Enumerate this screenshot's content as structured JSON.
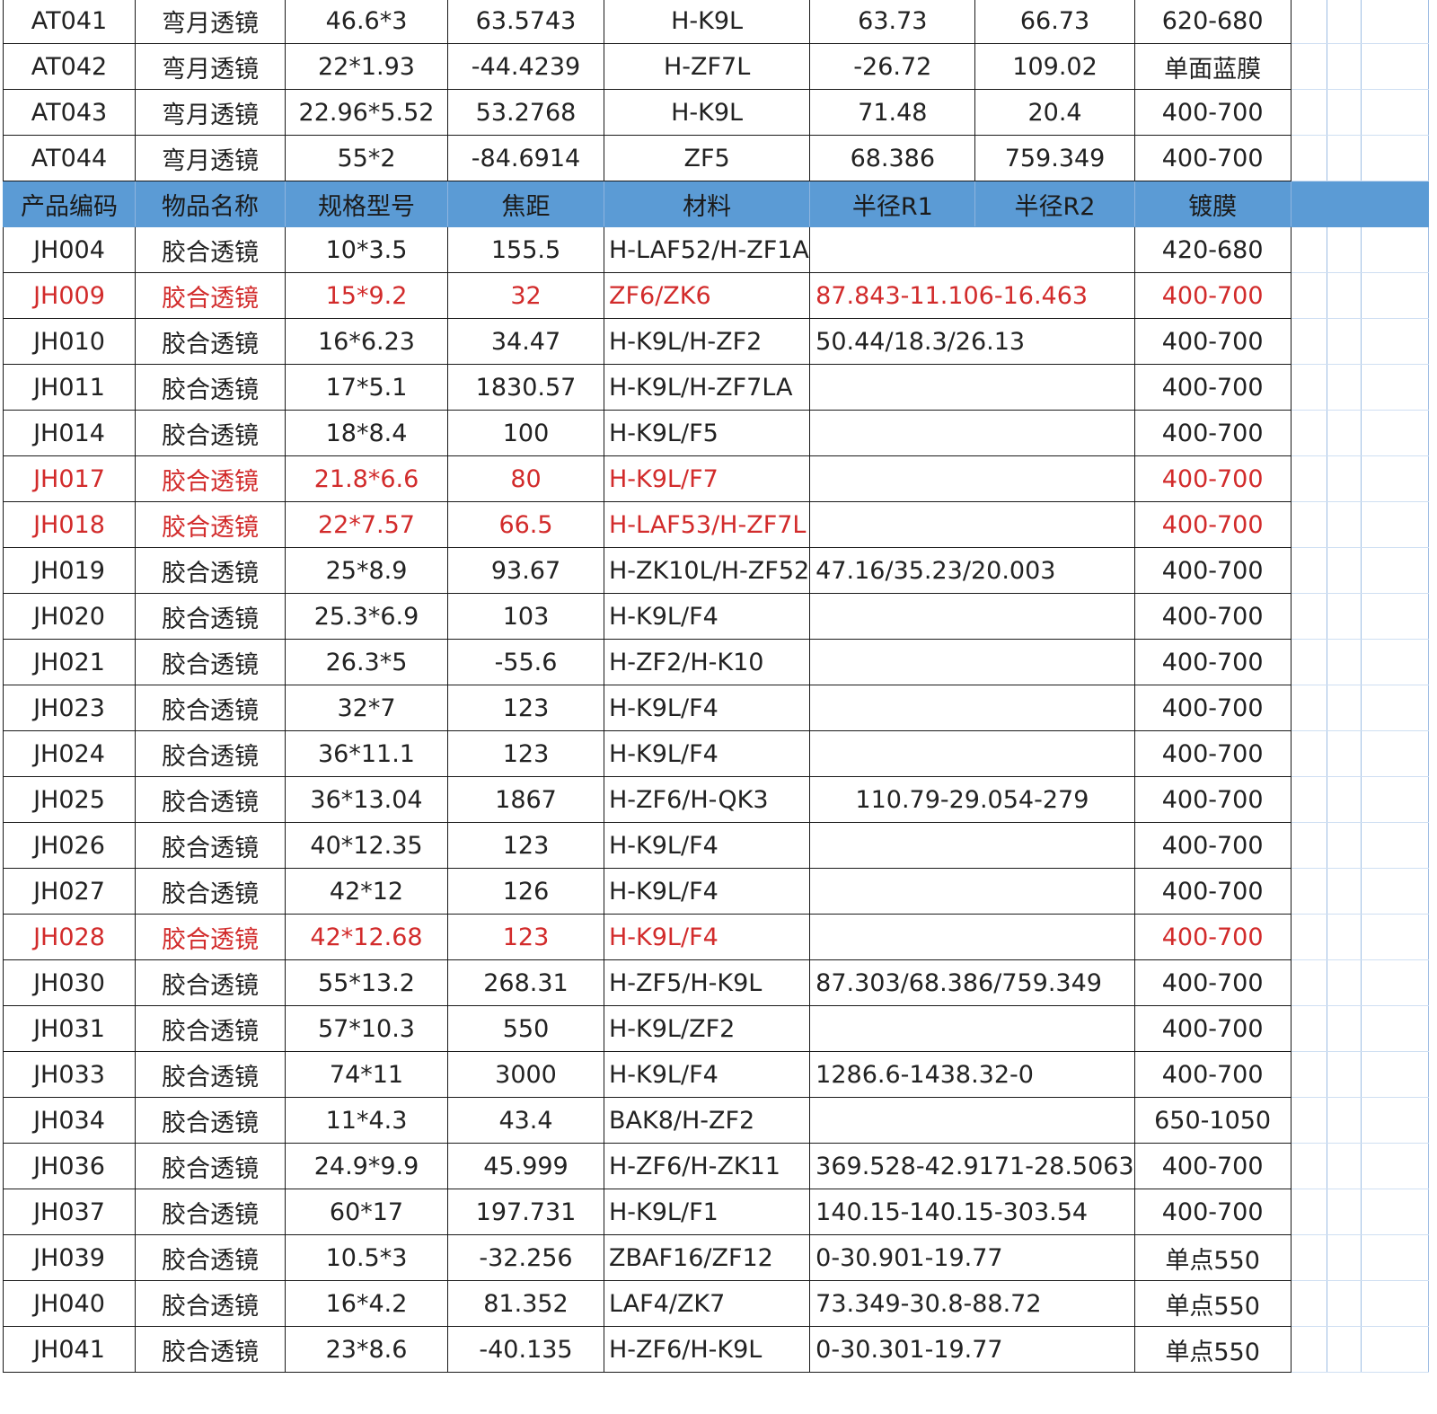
{
  "top_rows": [
    {
      "code": "AT041",
      "name": "弯月透镜",
      "spec": "46.6*3",
      "focal": "63.5743",
      "material": "H-K9L",
      "r1": "63.73",
      "r2": "66.73",
      "coating": "620-680"
    },
    {
      "code": "AT042",
      "name": "弯月透镜",
      "spec": "22*1.93",
      "focal": "-44.4239",
      "material": "H-ZF7L",
      "r1": "-26.72",
      "r2": "109.02",
      "coating": "单面蓝膜"
    },
    {
      "code": "AT043",
      "name": "弯月透镜",
      "spec": "22.96*5.52",
      "focal": "53.2768",
      "material": "H-K9L",
      "r1": "71.48",
      "r2": "20.4",
      "coating": "400-700"
    },
    {
      "code": "AT044",
      "name": "弯月透镜",
      "spec": "55*2",
      "focal": "-84.6914",
      "material": "ZF5",
      "r1": "68.386",
      "r2": "759.349",
      "coating": "400-700"
    }
  ],
  "header": {
    "code": "产品编码",
    "name": "物品名称",
    "spec": "规格型号",
    "focal": "焦距",
    "material": "材料",
    "r1": "半径R1",
    "r2": "半径R2",
    "coating": "镀膜"
  },
  "rows": [
    {
      "code": "JH004",
      "name": "胶合透镜",
      "spec": "10*3.5",
      "focal": "155.5",
      "material": "H-LAF52/H-ZF1A",
      "radius": "",
      "coating": "420-680",
      "red": false
    },
    {
      "code": "JH009",
      "name": "胶合透镜",
      "spec": "15*9.2",
      "focal": "32",
      "material": "ZF6/ZK6",
      "radius": "87.843-11.106-16.463",
      "coating": "400-700",
      "red": true
    },
    {
      "code": "JH010",
      "name": "胶合透镜",
      "spec": "16*6.23",
      "focal": "34.47",
      "material": "H-K9L/H-ZF2",
      "radius": "50.44/18.3/26.13",
      "coating": "400-700",
      "red": false
    },
    {
      "code": "JH011",
      "name": "胶合透镜",
      "spec": "17*5.1",
      "focal": "1830.57",
      "material": "H-K9L/H-ZF7LA",
      "radius": "",
      "coating": "400-700",
      "red": false
    },
    {
      "code": "JH014",
      "name": "胶合透镜",
      "spec": "18*8.4",
      "focal": "100",
      "material": "H-K9L/F5",
      "radius": "",
      "coating": "400-700",
      "red": false
    },
    {
      "code": "JH017",
      "name": "胶合透镜",
      "spec": "21.8*6.6",
      "focal": "80",
      "material": "H-K9L/F7",
      "radius": "",
      "coating": "400-700",
      "red": true
    },
    {
      "code": "JH018",
      "name": "胶合透镜",
      "spec": "22*7.57",
      "focal": "66.5",
      "material": "H-LAF53/H-ZF7L",
      "radius": "",
      "coating": "400-700",
      "red": true
    },
    {
      "code": "JH019",
      "name": "胶合透镜",
      "spec": "25*8.9",
      "focal": "93.67",
      "material": "H-ZK10L/H-ZF52",
      "radius": "47.16/35.23/20.003",
      "coating": "400-700",
      "red": false
    },
    {
      "code": "JH020",
      "name": "胶合透镜",
      "spec": "25.3*6.9",
      "focal": "103",
      "material": "H-K9L/F4",
      "radius": "",
      "coating": "400-700",
      "red": false
    },
    {
      "code": "JH021",
      "name": "胶合透镜",
      "spec": "26.3*5",
      "focal": "-55.6",
      "material": "H-ZF2/H-K10",
      "radius": "",
      "coating": "400-700",
      "red": false
    },
    {
      "code": "JH023",
      "name": "胶合透镜",
      "spec": "32*7",
      "focal": "123",
      "material": "H-K9L/F4",
      "radius": "",
      "coating": "400-700",
      "red": false
    },
    {
      "code": "JH024",
      "name": "胶合透镜",
      "spec": "36*11.1",
      "focal": "123",
      "material": "H-K9L/F4",
      "radius": "",
      "coating": "400-700",
      "red": false
    },
    {
      "code": "JH025",
      "name": "胶合透镜",
      "spec": "36*13.04",
      "focal": "1867",
      "material": "H-ZF6/H-QK3",
      "radius": "110.79-29.054-279",
      "coating": "400-700",
      "red": false,
      "center": true
    },
    {
      "code": "JH026",
      "name": "胶合透镜",
      "spec": "40*12.35",
      "focal": "123",
      "material": "H-K9L/F4",
      "radius": "",
      "coating": "400-700",
      "red": false
    },
    {
      "code": "JH027",
      "name": "胶合透镜",
      "spec": "42*12",
      "focal": "126",
      "material": "H-K9L/F4",
      "radius": "",
      "coating": "400-700",
      "red": false
    },
    {
      "code": "JH028",
      "name": "胶合透镜",
      "spec": "42*12.68",
      "focal": "123",
      "material": "H-K9L/F4",
      "radius": "",
      "coating": "400-700",
      "red": true
    },
    {
      "code": "JH030",
      "name": "胶合透镜",
      "spec": "55*13.2",
      "focal": "268.31",
      "material": "H-ZF5/H-K9L",
      "radius": "87.303/68.386/759.349",
      "coating": "400-700",
      "red": false
    },
    {
      "code": "JH031",
      "name": "胶合透镜",
      "spec": "57*10.3",
      "focal": "550",
      "material": "H-K9L/ZF2",
      "radius": "",
      "coating": "400-700",
      "red": false
    },
    {
      "code": "JH033",
      "name": "胶合透镜",
      "spec": "74*11",
      "focal": "3000",
      "material": "H-K9L/F4",
      "radius": "1286.6-1438.32-0",
      "coating": "400-700",
      "red": false
    },
    {
      "code": "JH034",
      "name": "胶合透镜",
      "spec": "11*4.3",
      "focal": "43.4",
      "material": "BAK8/H-ZF2",
      "radius": "",
      "coating": "650-1050",
      "red": false
    },
    {
      "code": "JH036",
      "name": "胶合透镜",
      "spec": "24.9*9.9",
      "focal": "45.999",
      "material": "H-ZF6/H-ZK11",
      "radius": "369.528-42.9171-28.5063",
      "coating": "400-700",
      "red": false
    },
    {
      "code": "JH037",
      "name": "胶合透镜",
      "spec": "60*17",
      "focal": "197.731",
      "material": "H-K9L/F1",
      "radius": "140.15-140.15-303.54",
      "coating": "400-700",
      "red": false
    },
    {
      "code": "JH039",
      "name": "胶合透镜",
      "spec": "10.5*3",
      "focal": "-32.256",
      "material": "ZBAF16/ZF12",
      "radius": "0-30.901-19.77",
      "coating": "单点550",
      "red": false
    },
    {
      "code": "JH040",
      "name": "胶合透镜",
      "spec": "16*4.2",
      "focal": "81.352",
      "material": "LAF4/ZK7",
      "radius": "73.349-30.8-88.72",
      "coating": "单点550",
      "red": false
    },
    {
      "code": "JH041",
      "name": "胶合透镜",
      "spec": "23*8.6",
      "focal": "-40.135",
      "material": "H-ZF6/H-K9L",
      "radius": "0-30.301-19.77",
      "coating": "单点550",
      "red": false
    }
  ]
}
